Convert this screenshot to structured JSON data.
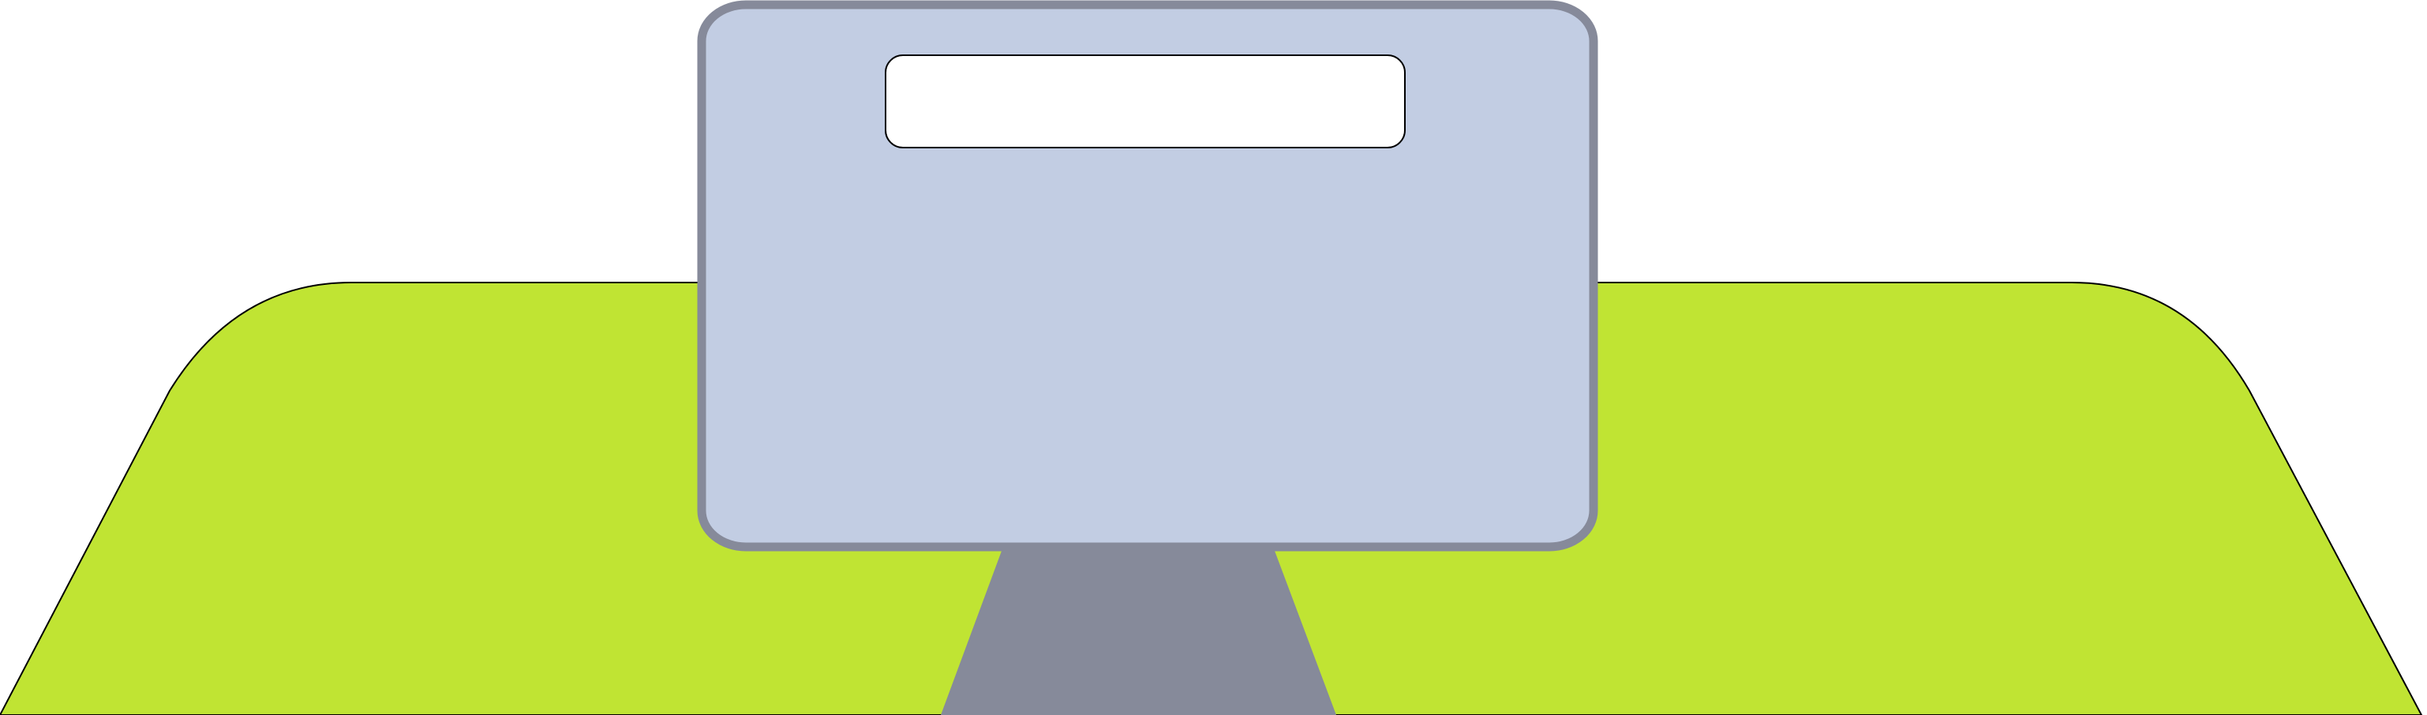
{
  "scene": {
    "description_label": "",
    "colors": {
      "background": "#ffffff",
      "table_fill": "#c0e433",
      "table_outline": "#000000",
      "monitor_frame": "#868a9a",
      "monitor_screen": "#c2cde3",
      "stand_fill": "#868a9a",
      "text_box_fill": "#ffffff",
      "text_box_outline": "#000000"
    },
    "elements": {
      "table": "table-surface",
      "monitor": "monitor-screen",
      "stand": "monitor-stand",
      "text_box": "screen-text-box"
    },
    "screen_text": ""
  }
}
